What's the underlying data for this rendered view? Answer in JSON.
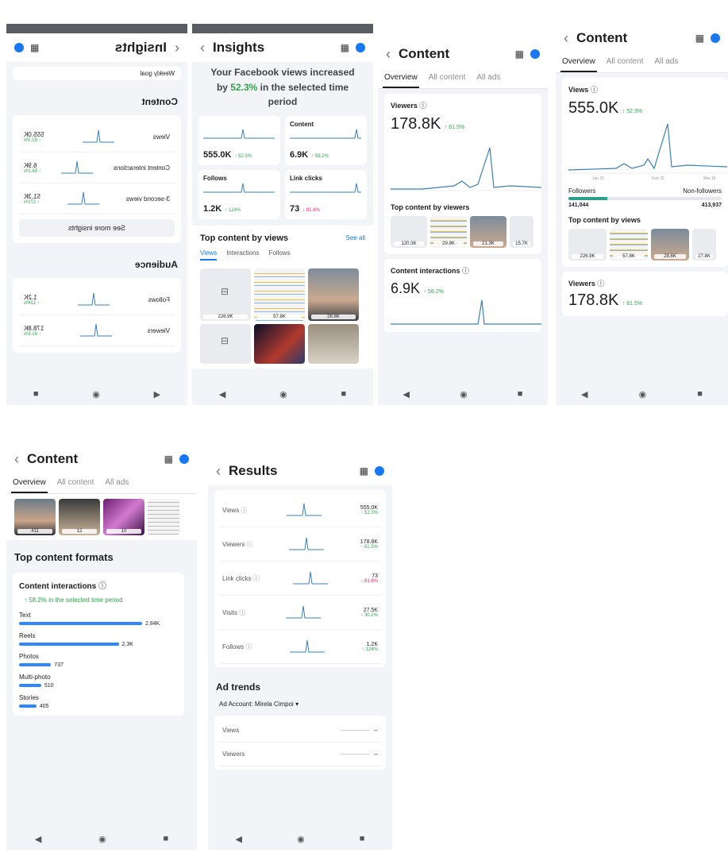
{
  "s1": {
    "title": "Insights",
    "weekly_goal": "Weekly goal",
    "content_header": "Content",
    "metrics": [
      {
        "label": "Views",
        "value": "555.0K",
        "change": "↑ 52.3%"
      },
      {
        "label": "Content interactions",
        "value": "6.9K",
        "change": "↑ 58.2%"
      },
      {
        "label": "3-second views",
        "value": "51.3K",
        "change": "↑ 271%"
      }
    ],
    "see_more": "See more insights",
    "audience_header": "Audience",
    "audience": [
      {
        "label": "Follows",
        "value": "1.2K",
        "change": "↑ 124%"
      },
      {
        "label": "Viewers",
        "value": "178.8K",
        "change": "↑ 61.5%"
      }
    ]
  },
  "s2": {
    "title": "Insights",
    "headline_pre": "Your Facebook views increased by ",
    "headline_pct": "52.3%",
    "headline_post": " in the selected time period",
    "tiles": [
      {
        "label": "",
        "value": "555.0K",
        "change": "↑ 52.3%",
        "neg": false
      },
      {
        "label": "Content",
        "value": "6.9K",
        "change": "↑ 58.2%",
        "neg": false
      },
      {
        "label": "Follows",
        "value": "1.2K",
        "change": "↑ 124%",
        "neg": false
      },
      {
        "label": "Link clicks",
        "value": "73",
        "change": "↓ 81.6%",
        "neg": true
      }
    ],
    "top_title": "Top content by views",
    "see_all": "See all",
    "tabs": [
      "Views",
      "Interactions",
      "Follows"
    ],
    "thumb_labels": [
      "226.9K",
      "57.8K",
      "28.6K"
    ]
  },
  "s3": {
    "title": "Content",
    "tabs": [
      "Overview",
      "All content",
      "All ads"
    ],
    "viewers_label": "Viewers",
    "viewers_value": "178.8K",
    "viewers_change": "↑ 61.5%",
    "top_title": "Top content by viewers",
    "thumb_labels": [
      "120.3K",
      "29.9K",
      "21.3K",
      "15.7K"
    ],
    "ci_label": "Content interactions",
    "ci_value": "6.9K",
    "ci_change": "↑ 58.2%"
  },
  "s4": {
    "title": "Content",
    "tabs": [
      "Overview",
      "All content",
      "All ads"
    ],
    "views_label": "Views",
    "views_value": "555.0K",
    "views_change": "↑ 52.3%",
    "axis": [
      "Jan 15",
      "Feb 15",
      "Mar 15"
    ],
    "followers": "Followers",
    "non_followers": "Non-followers",
    "followers_count": "141,044",
    "non_followers_count": "413,937",
    "followers_share": 0.254,
    "top_title": "Top content by views",
    "thumb_labels": [
      "226.9K",
      "57.8K",
      "28.6K",
      "27.8K"
    ],
    "viewers_label": "Viewers",
    "viewers_value": "178.8K",
    "viewers_change": "↑ 61.5%"
  },
  "s5": {
    "title": "Content",
    "tabs": [
      "Overview",
      "All content",
      "All ads"
    ],
    "thumb_labels": [
      "411",
      "12",
      "10"
    ],
    "formats_title": "Top content formats",
    "ci_label": "Content interactions",
    "ci_note": "↑ 58.2% in the selected time period",
    "formats": [
      {
        "name": "Text",
        "value": "2.84K",
        "frac": 1.0
      },
      {
        "name": "Reels",
        "value": "2.3K",
        "frac": 0.81
      },
      {
        "name": "Photos",
        "value": "737",
        "frac": 0.26
      },
      {
        "name": "Multi-photo",
        "value": "510",
        "frac": 0.18
      },
      {
        "name": "Stories",
        "value": "405",
        "frac": 0.14
      }
    ]
  },
  "s6": {
    "title": "Results",
    "rows": [
      {
        "label": "Views",
        "value": "555.0K",
        "change": "↑ 52.3%",
        "neg": false
      },
      {
        "label": "Viewers",
        "value": "178.8K",
        "change": "↑ 61.5%",
        "neg": false
      },
      {
        "label": "Link clicks",
        "value": "73",
        "change": "↓ 81.6%",
        "neg": true
      },
      {
        "label": "Visits",
        "value": "27.5K",
        "change": "↑ 30.2%",
        "neg": false
      },
      {
        "label": "Follows",
        "value": "1.2K",
        "change": "↑ 124%",
        "neg": false
      }
    ],
    "ad_trends": "Ad trends",
    "ad_account": "Ad Account: Mirela Cimpoi",
    "ad_rows": [
      {
        "label": "Views",
        "value": "--"
      },
      {
        "label": "Viewers",
        "value": "--"
      }
    ]
  },
  "icons": {
    "back": "chevron-left-icon",
    "calendar": "calendar-icon",
    "profile": "facebook-profile-icon"
  }
}
